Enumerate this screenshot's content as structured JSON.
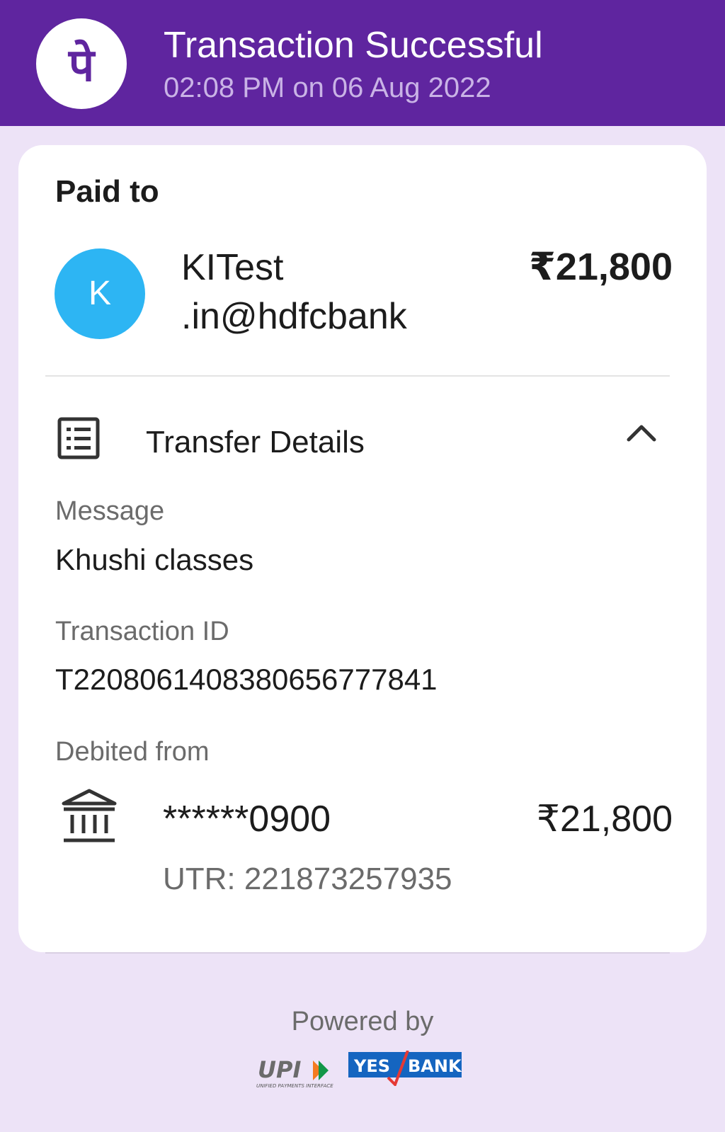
{
  "header": {
    "title": "Transaction Successful",
    "subtitle": "02:08 PM on 06 Aug 2022",
    "brand_color": "#5f259f",
    "logo_icon": "phonepe-logo-icon",
    "logo_glyph": "पे"
  },
  "payment": {
    "section_label": "Paid to",
    "avatar_letter": "K",
    "avatar_color": "#2db5f3",
    "payee_name_line1": "KITest",
    "payee_name_line2": ".in@hdfcbank",
    "amount": "₹21,800"
  },
  "transfer_details": {
    "title": "Transfer Details",
    "icon": "list-icon",
    "toggle_icon": "chevron-up-icon",
    "message_label": "Message",
    "message_value": "Khushi classes",
    "transaction_id_label": "Transaction ID",
    "transaction_id_value": "T2208061408380656777841",
    "debited_from_label": "Debited from",
    "bank_icon": "bank-icon",
    "account_masked": "******0900",
    "debited_amount": "₹21,800",
    "utr": "UTR: 221873257935"
  },
  "footer": {
    "powered_by": "Powered by",
    "upi_logo_text": "UPI",
    "upi_tagline": "UNIFIED PAYMENTS INTERFACE",
    "yes_bank_yes": "YES",
    "yes_bank_bank": "BANK"
  }
}
